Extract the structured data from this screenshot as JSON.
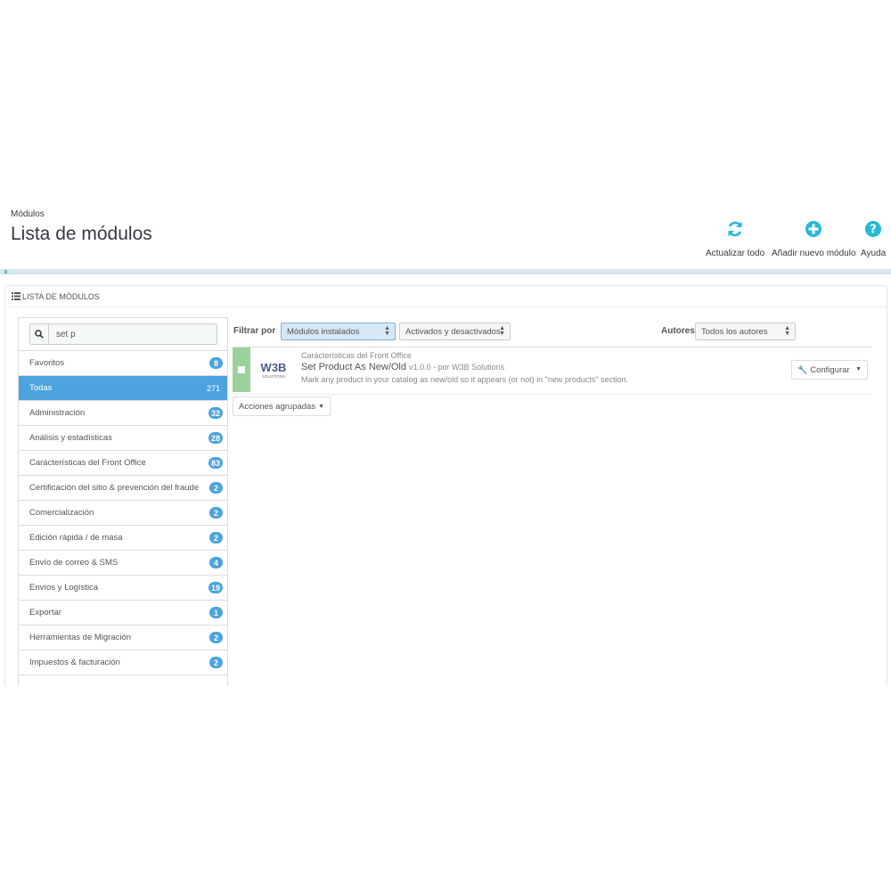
{
  "header": {
    "breadcrumb": "Módulos",
    "title": "Lista de módulos",
    "toolbar": [
      {
        "label": "Actualizar todo",
        "icon": "refresh-icon"
      },
      {
        "label": "Añadir nuevo módulo",
        "icon": "add-circle-icon"
      },
      {
        "label": "Ayuda",
        "icon": "help-icon"
      }
    ]
  },
  "panel": {
    "title": "LISTA DE MÓDULOS"
  },
  "sidebar": {
    "search_value": "set p",
    "categories": [
      {
        "label": "Favoritos",
        "count": "8"
      },
      {
        "label": "Todas",
        "count": "271",
        "active": true
      },
      {
        "label": "Administración",
        "count": "32"
      },
      {
        "label": "Análisis y estadísticas",
        "count": "28"
      },
      {
        "label": "Carácterísticas del Front Office",
        "count": "83"
      },
      {
        "label": "Certificación del sitio & prevención del fraude",
        "count": "2"
      },
      {
        "label": "Comercialización",
        "count": "2"
      },
      {
        "label": "Edición rápida / de masa",
        "count": "2"
      },
      {
        "label": "Envío de correo & SMS",
        "count": "4"
      },
      {
        "label": "Envíos y Logística",
        "count": "19"
      },
      {
        "label": "Exportar",
        "count": "1"
      },
      {
        "label": "Herramientas de Migración",
        "count": "2"
      },
      {
        "label": "Impuestos & facturación",
        "count": "2"
      }
    ]
  },
  "filters": {
    "label": "Filtrar por",
    "installed": "Módulos instalados",
    "status": "Activados y desactivados",
    "authors_label": "Autores",
    "authors": "Todos los autores"
  },
  "module": {
    "category": "Carácterísticas del Front Office",
    "name": "Set Product As New/Old",
    "version": "v1.0.0 - por W3B Solutions",
    "description": "Mark any product in your catalog as new/old so it appears (or not) in \"new products\" section.",
    "configure_label": "Configurar",
    "logo_text": "W3B",
    "logo_sub": "SOLUTIONS"
  },
  "bulk_actions_label": "Acciones agrupadas",
  "colors": {
    "accent": "#4ca3dd",
    "row_status": "#9bd29c",
    "header_bar": "#d6e7ef"
  }
}
